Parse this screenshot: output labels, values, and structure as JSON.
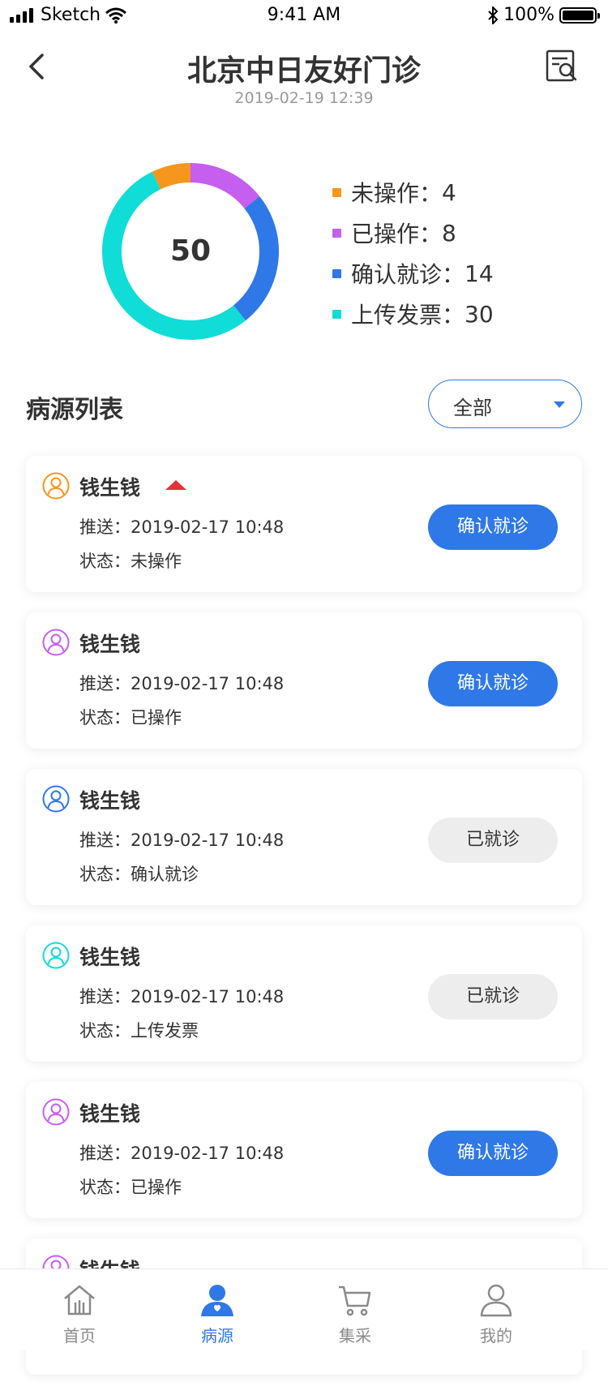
{
  "status_bar": {
    "carrier": "Sketch",
    "time": "9:41 AM",
    "battery": "100%"
  },
  "header": {
    "title": "北京中日友好门诊",
    "subtitle": "2019-02-19 12:39"
  },
  "summary": {
    "total": "50",
    "legend": [
      {
        "label": "未操作：",
        "value": "4",
        "color": "#f7961d"
      },
      {
        "label": "已操作：",
        "value": "8",
        "color": "#c65ef0"
      },
      {
        "label": "确认就诊：",
        "value": "14",
        "color": "#2f78e8"
      },
      {
        "label": "上传发票：",
        "value": "30",
        "color": "#10dcd8"
      }
    ]
  },
  "list": {
    "title": "病源列表",
    "filter_label": "全部"
  },
  "cards": [
    {
      "name": "钱生钱",
      "push_label": "推送：",
      "push_time": "2019-02-17 10:48",
      "status_label": "状态：",
      "status": "未操作",
      "button": "确认就诊",
      "avatar_color": "#f7961d"
    },
    {
      "name": "钱生钱",
      "push_label": "推送：",
      "push_time": "2019-02-17 10:48",
      "status_label": "状态：",
      "status": "已操作",
      "button": "确认就诊",
      "avatar_color": "#c65ef0"
    },
    {
      "name": "钱生钱",
      "push_label": "推送：",
      "push_time": "2019-02-17 10:48",
      "status_label": "状态：",
      "status": "确认就诊",
      "button": "已就诊",
      "avatar_color": "#2f78e8"
    },
    {
      "name": "钱生钱",
      "push_label": "推送：",
      "push_time": "2019-02-17 10:48",
      "status_label": "状态：",
      "status": "上传发票",
      "button": "已就诊",
      "avatar_color": "#10dcd8"
    },
    {
      "name": "钱生钱",
      "push_label": "推送：",
      "push_time": "2019-02-17 10:48",
      "status_label": "状态：",
      "status": "已操作",
      "button": "确认就诊",
      "avatar_color": "#c65ef0"
    },
    {
      "name": "钱生钱",
      "avatar_color": "#c65ef0"
    }
  ],
  "tabbar": [
    {
      "label": "首页",
      "icon": "home-icon"
    },
    {
      "label": "病源",
      "icon": "patient-source-icon"
    },
    {
      "label": "集采",
      "icon": "cart-icon"
    },
    {
      "label": "我的",
      "icon": "user-icon"
    }
  ]
}
